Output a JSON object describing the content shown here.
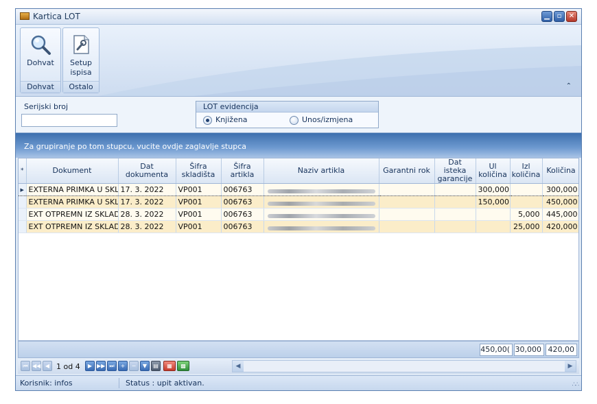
{
  "window": {
    "title": "Kartica LOT"
  },
  "ribbon": {
    "groups": [
      {
        "label": "Dohvat",
        "buttons": [
          {
            "label": "Dohvat",
            "icon": "magnifier-icon"
          }
        ]
      },
      {
        "label": "Ostalo",
        "buttons": [
          {
            "label": "Setup ispisa",
            "icon": "print-setup-icon"
          }
        ]
      }
    ],
    "collapse_glyph": "»"
  },
  "filter": {
    "serial_label": "Serijski broj",
    "serial_value": "",
    "lot_group_title": "LOT evidencija",
    "options": [
      {
        "label": "Knjižena",
        "selected": true
      },
      {
        "label": "Unos/izmjena",
        "selected": false
      }
    ]
  },
  "group_hint": "Za grupiranje po tom stupcu, vucite ovdje zaglavlje stupca",
  "table": {
    "indicator_header": "*",
    "columns": [
      "Dokument",
      "Dat dokumenta",
      "Šifra skladišta",
      "Šifra artikla",
      "Naziv artikla",
      "Garantni rok",
      "Dat isteka garancije",
      "Ul količina",
      "Izl količina",
      "Količina"
    ],
    "rows": [
      {
        "selected": true,
        "cells": [
          "EXTERNA PRIMKA U SKL",
          "17. 3. 2022",
          "VP001",
          "006763",
          "",
          "",
          "",
          "300,000",
          "",
          "300,000"
        ]
      },
      {
        "selected": false,
        "cells": [
          "EXTERNA PRIMKA U SKL",
          "17. 3. 2022",
          "VP001",
          "006763",
          "",
          "",
          "",
          "150,000",
          "",
          "450,000"
        ]
      },
      {
        "selected": false,
        "cells": [
          "EXT OTPREMN IZ SKLAD",
          "28. 3. 2022",
          "VP001",
          "006763",
          "",
          "",
          "",
          "",
          "5,000",
          "445,000"
        ]
      },
      {
        "selected": false,
        "cells": [
          "EXT OTPREMN IZ SKLAD",
          "28. 3. 2022",
          "VP001",
          "006763",
          "",
          "",
          "",
          "",
          "25,000",
          "420,000"
        ]
      }
    ],
    "totals": {
      "ul": "450,00(",
      "izl": "30,000",
      "kol": "420,00"
    }
  },
  "navigator": {
    "page_text": "1 od 4"
  },
  "statusbar": {
    "user": "Korisnik: infos",
    "status": "Status : upit aktivan."
  },
  "colors": {
    "accent": "#3d6fae",
    "row_alt": "#fbedc9",
    "row": "#fffbef"
  }
}
